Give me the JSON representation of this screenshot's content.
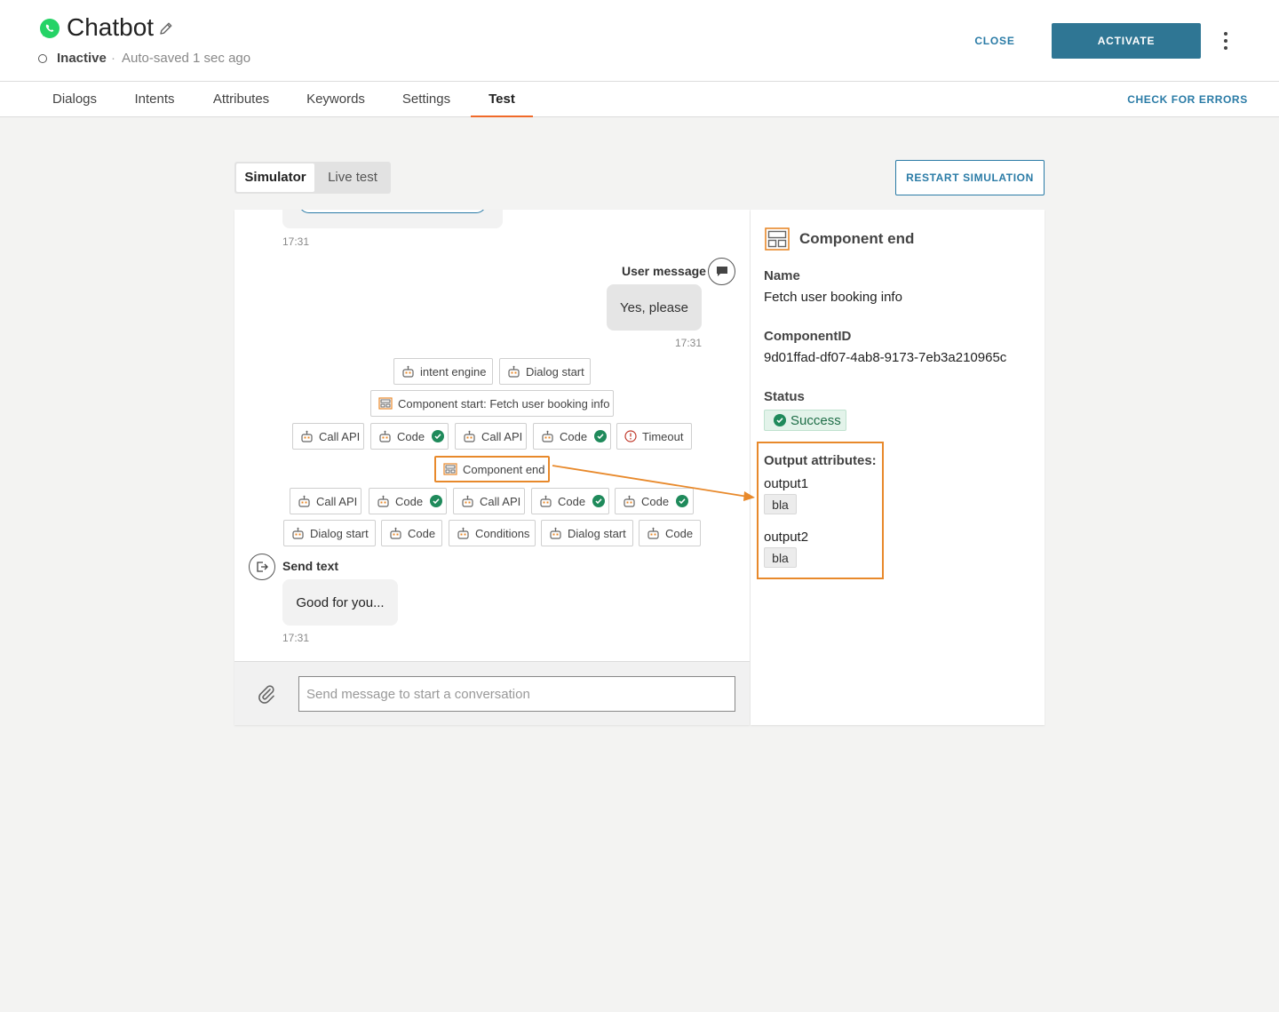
{
  "header": {
    "title": "Chatbot",
    "status": "Inactive",
    "separator": "·",
    "autosave": "Auto-saved 1 sec ago",
    "close_label": "CLOSE",
    "activate_label": "ACTIVATE"
  },
  "tabs": [
    {
      "label": "Dialogs"
    },
    {
      "label": "Intents"
    },
    {
      "label": "Attributes"
    },
    {
      "label": "Keywords"
    },
    {
      "label": "Settings"
    },
    {
      "label": "Test",
      "active": true
    }
  ],
  "check_errors_label": "CHECK FOR ERRORS",
  "mode": {
    "simulator": "Simulator",
    "live_test": "Live test",
    "restart_label": "RESTART SIMULATION"
  },
  "chat": {
    "ts_top": "17:31",
    "user_label": "User message",
    "user_text": "Yes, please",
    "ts_user": "17:31",
    "chips": {
      "intent_engine": "intent engine",
      "dialog_start": "Dialog start",
      "component_start": "Component start: Fetch user booking info",
      "call_api": "Call API",
      "code": "Code",
      "timeout": "Timeout",
      "component_end": "Component end",
      "conditions": "Conditions"
    },
    "send_label": "Send text",
    "bot_text": "Good for you...",
    "ts_bot": "17:31",
    "input_placeholder": "Send message to start a conversation"
  },
  "details": {
    "title": "Component end",
    "name_label": "Name",
    "name_value": "Fetch user booking info",
    "id_label": "ComponentID",
    "id_value": "9d01ffad-df07-4ab8-9173-7eb3a210965c",
    "status_label": "Status",
    "status_value": "Success",
    "output_label": "Output attributes:",
    "outputs": [
      {
        "name": "output1",
        "value": "bla"
      },
      {
        "name": "output2",
        "value": "bla"
      }
    ]
  },
  "colors": {
    "accent": "#2f7694",
    "link": "#2a7ba6",
    "active_tab": "#f06a2a",
    "highlight": "#e8892b",
    "success": "#1f8a5b"
  }
}
